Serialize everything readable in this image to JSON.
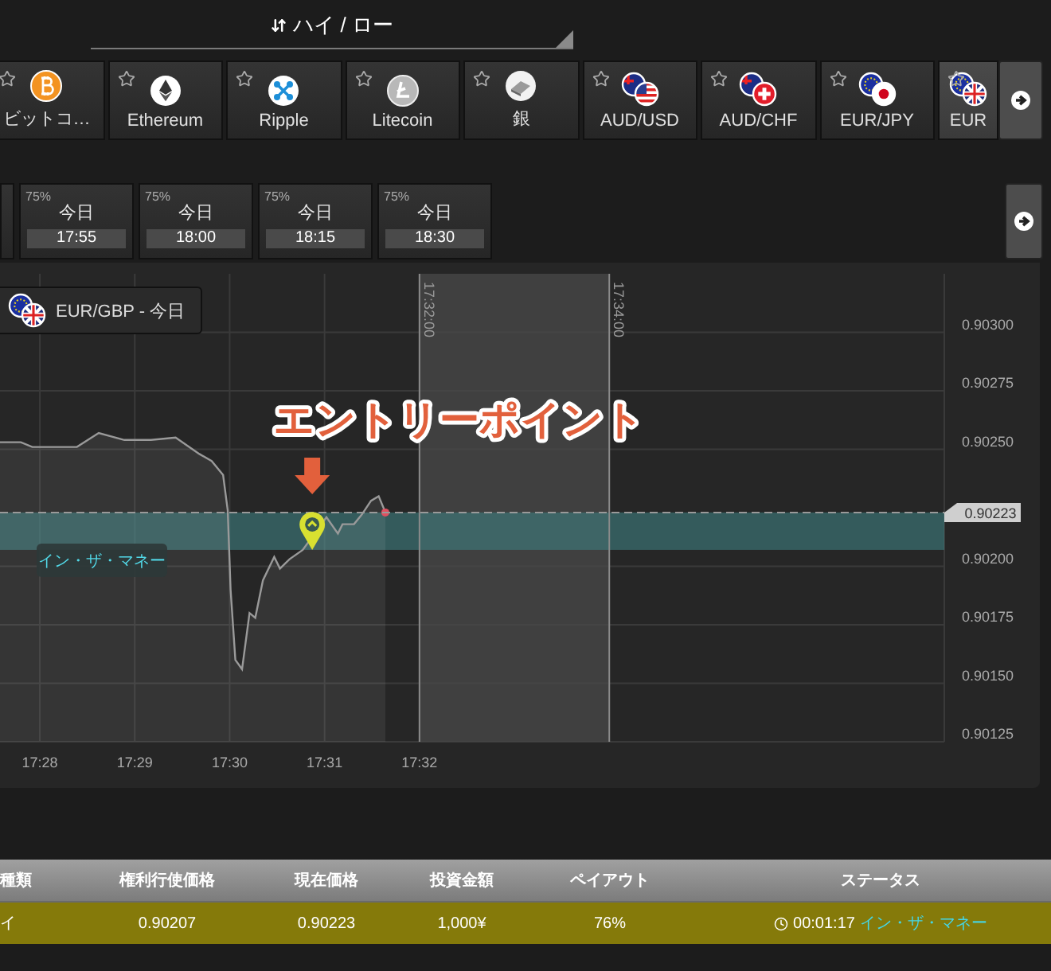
{
  "header": {
    "mode": "ハイ / ロー"
  },
  "assets": [
    {
      "label": "ビットコ…",
      "kind": "bitcoin",
      "selected": false
    },
    {
      "label": "Ethereum",
      "kind": "ethereum",
      "selected": false
    },
    {
      "label": "Ripple",
      "kind": "ripple",
      "selected": false
    },
    {
      "label": "Litecoin",
      "kind": "litecoin",
      "selected": false
    },
    {
      "label": "銀",
      "kind": "silver",
      "selected": false
    },
    {
      "label": "AUD/USD",
      "kind": "audusd",
      "selected": false
    },
    {
      "label": "AUD/CHF",
      "kind": "audchf",
      "selected": false
    },
    {
      "label": "EUR/JPY",
      "kind": "eurjpy",
      "selected": false
    },
    {
      "label": "EUR",
      "kind": "eurgbp",
      "selected": true
    }
  ],
  "expiries": [
    {
      "payout": "75%",
      "day": "今日",
      "time": "17:55"
    },
    {
      "payout": "75%",
      "day": "今日",
      "time": "18:00"
    },
    {
      "payout": "75%",
      "day": "今日",
      "time": "18:15"
    },
    {
      "payout": "75%",
      "day": "今日",
      "time": "18:30"
    }
  ],
  "chart": {
    "asset": {
      "label": "EUR/GBP - 今日",
      "kind": "eurgbp"
    },
    "chart_data": {
      "type": "area",
      "x": [
        1047.58,
        1047.8,
        1047.92,
        1048.39,
        1048.62,
        1048.89,
        1049.17,
        1049.43,
        1049.68,
        1049.81,
        1049.93,
        1049.98,
        1050.01,
        1050.06,
        1050.13,
        1050.21,
        1050.27,
        1050.35,
        1050.47,
        1050.53,
        1050.63,
        1050.77,
        1050.87,
        1051.02,
        1051.14,
        1051.19,
        1051.31,
        1051.39,
        1051.49,
        1051.57,
        1051.64
      ],
      "series": [
        {
          "color": "#9a9a9a",
          "values": [
            0.90253,
            0.90253,
            0.90251,
            0.90251,
            0.90257,
            0.90254,
            0.90254,
            0.90255,
            0.90248,
            0.90245,
            0.90239,
            0.90224,
            0.9019,
            0.9016,
            0.90156,
            0.9018,
            0.90178,
            0.90194,
            0.90204,
            0.90199,
            0.90203,
            0.90207,
            null,
            0.90221,
            0.90214,
            0.90218,
            0.90218,
            0.90222,
            0.90228,
            0.9023,
            0.90223
          ]
        }
      ],
      "xlim": [
        1047.58,
        1057.53
      ],
      "ylim": [
        0.90125,
        0.90325
      ],
      "grid": true,
      "xticks": [
        {
          "value": 1048,
          "label": "17:28"
        },
        {
          "value": 1049,
          "label": "17:29"
        },
        {
          "value": 1050,
          "label": "17:30"
        },
        {
          "value": 1051,
          "label": "17:31"
        },
        {
          "value": 1052,
          "label": "17:32"
        }
      ],
      "yticks": [
        {
          "value": 0.903,
          "label": "0.90300"
        },
        {
          "value": 0.90275,
          "label": "0.90275"
        },
        {
          "value": 0.9025,
          "label": "0.90250"
        },
        {
          "value": 0.902,
          "label": "0.90200"
        },
        {
          "value": 0.90175,
          "label": "0.90175"
        },
        {
          "value": 0.9015,
          "label": "0.90150"
        },
        {
          "value": 0.90125,
          "label": "0.90125"
        }
      ],
      "bands": [
        {
          "axis": "x",
          "from": 1052,
          "to": 1054
        },
        {
          "axis": "y",
          "from": 0.90207,
          "to": 0.90223,
          "label": "イン・ザ・マネー"
        }
      ],
      "ref_lines": [
        {
          "axis": "x",
          "value": 1052
        },
        {
          "axis": "x",
          "value": 1054
        },
        {
          "axis": "y",
          "value": 0.90223,
          "label": "0.90223"
        }
      ],
      "annotations": [
        {
          "text": "17:32:00",
          "x": 1052
        },
        {
          "text": "17:34:00",
          "x": 1054
        },
        {
          "text": "エントリーポイント",
          "x": 1050.87,
          "y": 0.90207
        }
      ]
    }
  },
  "positions": {
    "columns": [
      "種類",
      "権利行使価格",
      "現在価格",
      "投資金額",
      "ペイアウト",
      "ステータス"
    ],
    "rows": [
      {
        "type": "イ",
        "strike": "0.90207",
        "current": "0.90223",
        "amount": "1,000¥",
        "payout": "76%",
        "time": "00:01:17",
        "status": "イン・ザ・マネー"
      }
    ]
  }
}
